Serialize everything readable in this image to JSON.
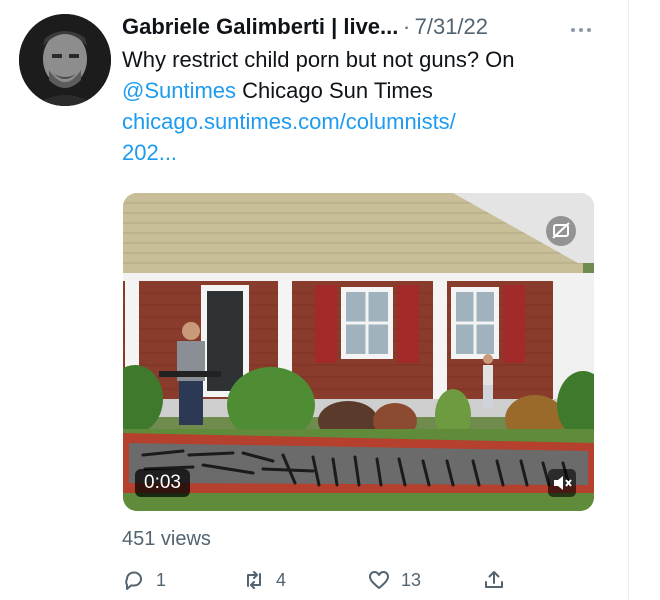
{
  "tweet": {
    "author_name": "Gabriele Galimberti | live...",
    "separator": "·",
    "date": "7/31/22",
    "more_icon": "more-horizontal-icon",
    "text_line1": "Why restrict child porn but not guns? On",
    "mention": "@Suntimes",
    "text_line2_rest": " Chicago Sun Times",
    "url_line1": "chicago.suntimes.com/columnists/",
    "url_line2": "202..."
  },
  "media": {
    "duration": "0:03",
    "mute_icon": "volume-muted-icon",
    "badge_icon": "media-settings-icon"
  },
  "stats": {
    "views": "451 views"
  },
  "actions": {
    "replies": "1",
    "retweets": "4",
    "likes": "13"
  },
  "colors": {
    "link": "#1d9bf0",
    "secondary_text": "#536471",
    "primary_text": "#0f1419"
  }
}
